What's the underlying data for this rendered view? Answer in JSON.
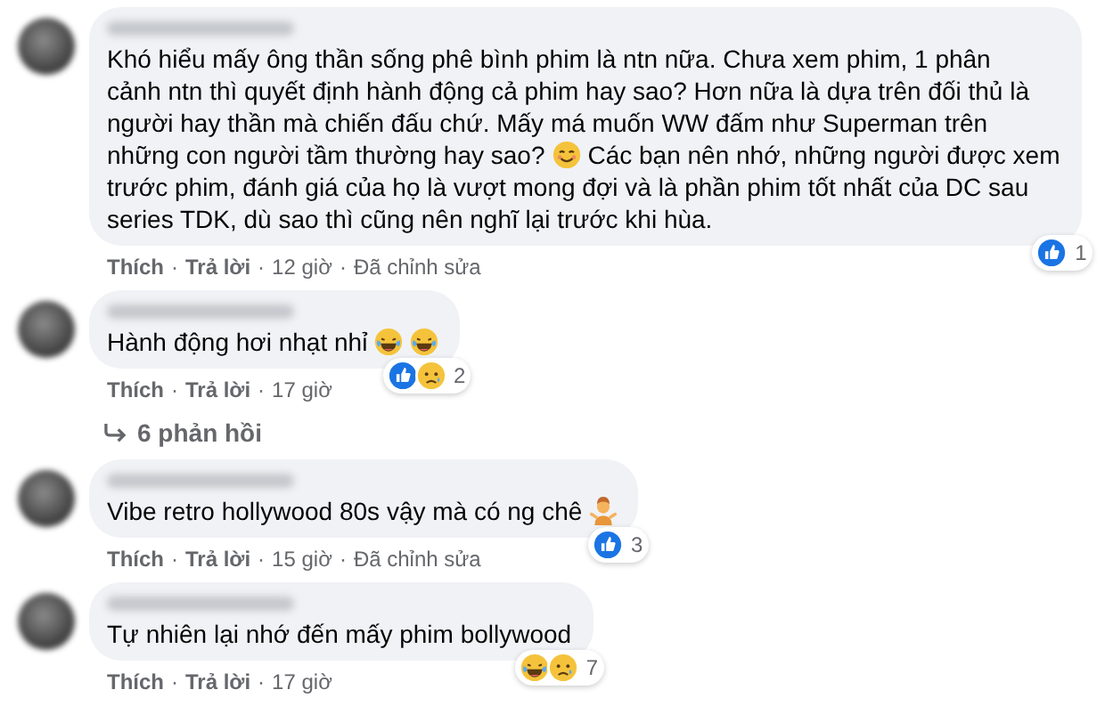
{
  "comments": [
    {
      "lines": [
        [
          {
            "kind": "text",
            "text": "Khó hiểu mấy ông thần sống phê bình phim là ntn nữa. Chưa xem phim, 1 phân"
          }
        ],
        [
          {
            "kind": "text",
            "text": "cảnh ntn thì quyết định hành động cả phim hay sao? Hơn nữa là dựa trên đối thủ là"
          }
        ],
        [
          {
            "kind": "text",
            "text": "người hay thần mà chiến đấu chứ. Mấy má muốn WW đấm như Superman trên"
          }
        ],
        [
          {
            "kind": "text",
            "text": "những con người tầm thường hay sao?"
          },
          {
            "kind": "smile"
          },
          {
            "kind": "text",
            "text": "Các bạn nên nhớ, những người được xem"
          }
        ],
        [
          {
            "kind": "text",
            "text": "trước phim, đánh giá của họ là vượt mong đợi và là phần phim tốt nhất của DC sau"
          }
        ],
        [
          {
            "kind": "text",
            "text": "series TDK, dù sao thì cũng nên nghĩ lại trước khi hùa."
          }
        ]
      ],
      "reactions": {
        "icons": [
          {
            "kind": "like"
          }
        ],
        "count": "1"
      },
      "actions": [
        {
          "kind": "link",
          "text": "Thích"
        },
        {
          "kind": "sep",
          "text": "·"
        },
        {
          "kind": "link",
          "text": "Trả lời"
        },
        {
          "kind": "sep",
          "text": "·"
        },
        {
          "kind": "time",
          "text": "12 giờ"
        },
        {
          "kind": "sep",
          "text": "·"
        },
        {
          "kind": "note",
          "text": "Đã chỉnh sửa"
        }
      ]
    },
    {
      "lines": [
        [
          {
            "kind": "text",
            "text": "Hành động hơi nhạt nhỉ"
          },
          {
            "kind": "laugh"
          },
          {
            "kind": "laugh"
          }
        ]
      ],
      "reactions": {
        "icons": [
          {
            "kind": "like"
          },
          {
            "kind": "sad"
          }
        ],
        "count": "2"
      },
      "actions": [
        {
          "kind": "link",
          "text": "Thích"
        },
        {
          "kind": "sep",
          "text": "·"
        },
        {
          "kind": "link",
          "text": "Trả lời"
        },
        {
          "kind": "sep",
          "text": "·"
        },
        {
          "kind": "time",
          "text": "17 giờ"
        }
      ],
      "replies": {
        "label": "6 phản hồi"
      }
    },
    {
      "lines": [
        [
          {
            "kind": "text",
            "text": "Vibe retro hollywood 80s vậy mà có ng chê"
          },
          {
            "kind": "shrug"
          }
        ]
      ],
      "reactions": {
        "icons": [
          {
            "kind": "like"
          }
        ],
        "count": "3"
      },
      "actions": [
        {
          "kind": "link",
          "text": "Thích"
        },
        {
          "kind": "sep",
          "text": "·"
        },
        {
          "kind": "link",
          "text": "Trả lời"
        },
        {
          "kind": "sep",
          "text": "·"
        },
        {
          "kind": "time",
          "text": "15 giờ"
        },
        {
          "kind": "sep",
          "text": "·"
        },
        {
          "kind": "note",
          "text": "Đã chỉnh sửa"
        }
      ]
    },
    {
      "lines": [
        [
          {
            "kind": "text",
            "text": "Tự nhiên lại nhớ đến mấy phim bollywood"
          }
        ]
      ],
      "reactions": {
        "icons": [
          {
            "kind": "laugh"
          },
          {
            "kind": "sad"
          }
        ],
        "count": "7"
      },
      "actions": [
        {
          "kind": "link",
          "text": "Thích"
        },
        {
          "kind": "sep",
          "text": "·"
        },
        {
          "kind": "link",
          "text": "Trả lời"
        },
        {
          "kind": "sep",
          "text": "·"
        },
        {
          "kind": "time",
          "text": "17 giờ"
        }
      ]
    }
  ]
}
